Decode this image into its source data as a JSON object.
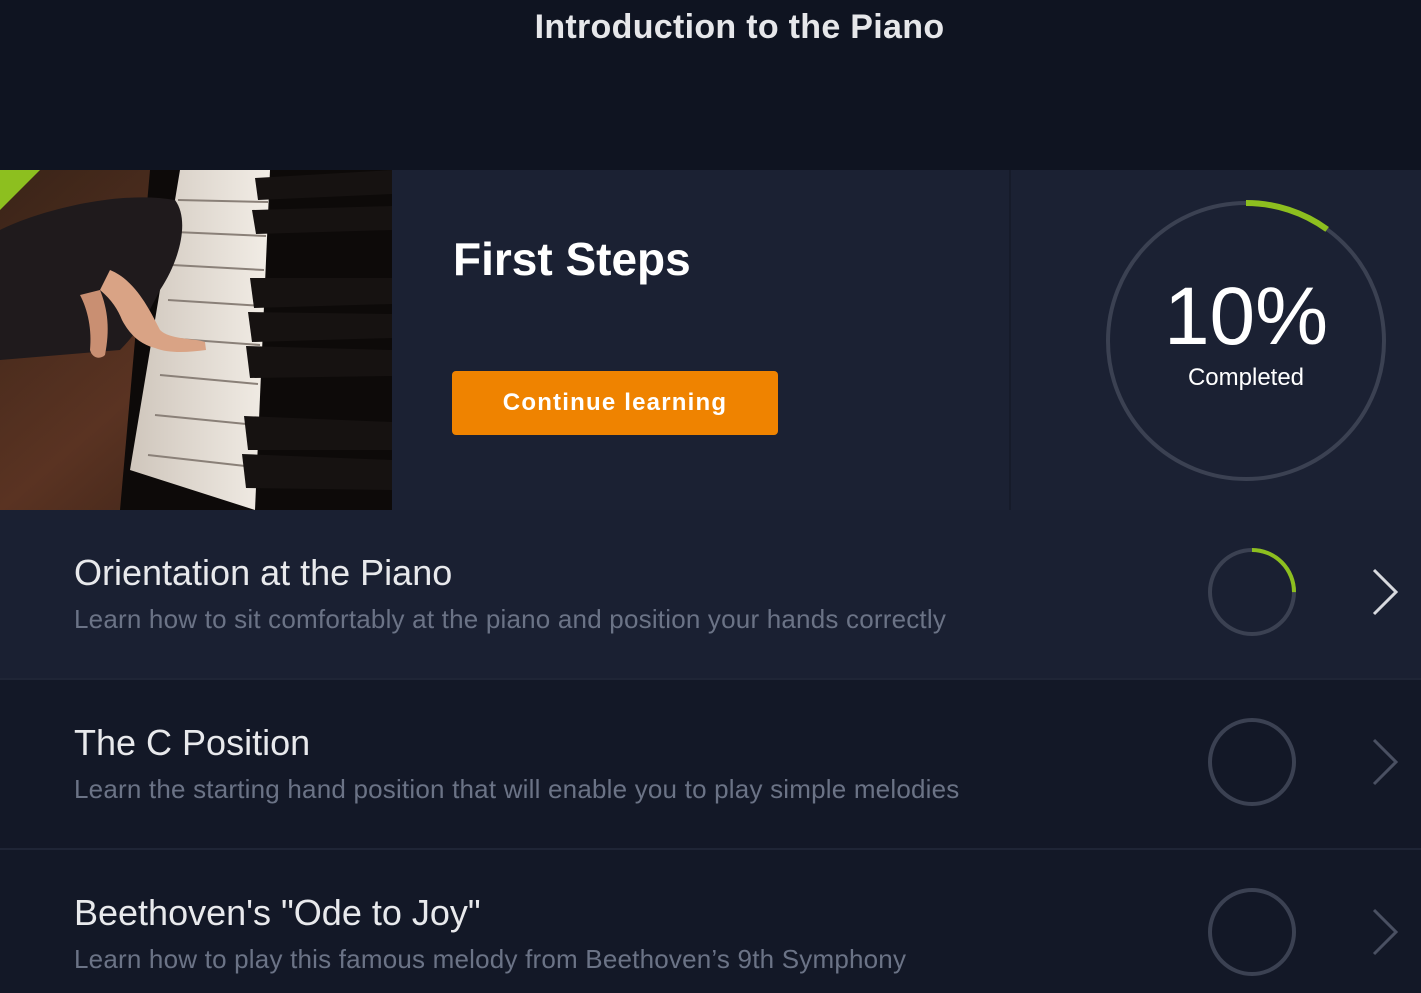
{
  "header": {
    "title": "Introduction to the Piano"
  },
  "course": {
    "title": "First Steps",
    "cta_label": "Continue learning",
    "progress_text": "10%",
    "progress_value": 0.1,
    "progress_caption": "Completed"
  },
  "lessons": [
    {
      "title": "Orientation at the Piano",
      "description": "Learn how to sit comfortably at the piano and position your hands correctly",
      "progress": 0.25
    },
    {
      "title": "The C Position",
      "description": "Learn the starting hand position that will enable you to play simple melodies",
      "progress": 0
    },
    {
      "title": "Beethoven's \"Ode to Joy\"",
      "description": "Learn how to play this famous melody from Beethoven’s 9th Symphony",
      "progress": 0
    }
  ],
  "colors": {
    "accent_green": "#8dbf1f",
    "button_orange": "#ef8300",
    "ring_track": "#3b4152"
  }
}
